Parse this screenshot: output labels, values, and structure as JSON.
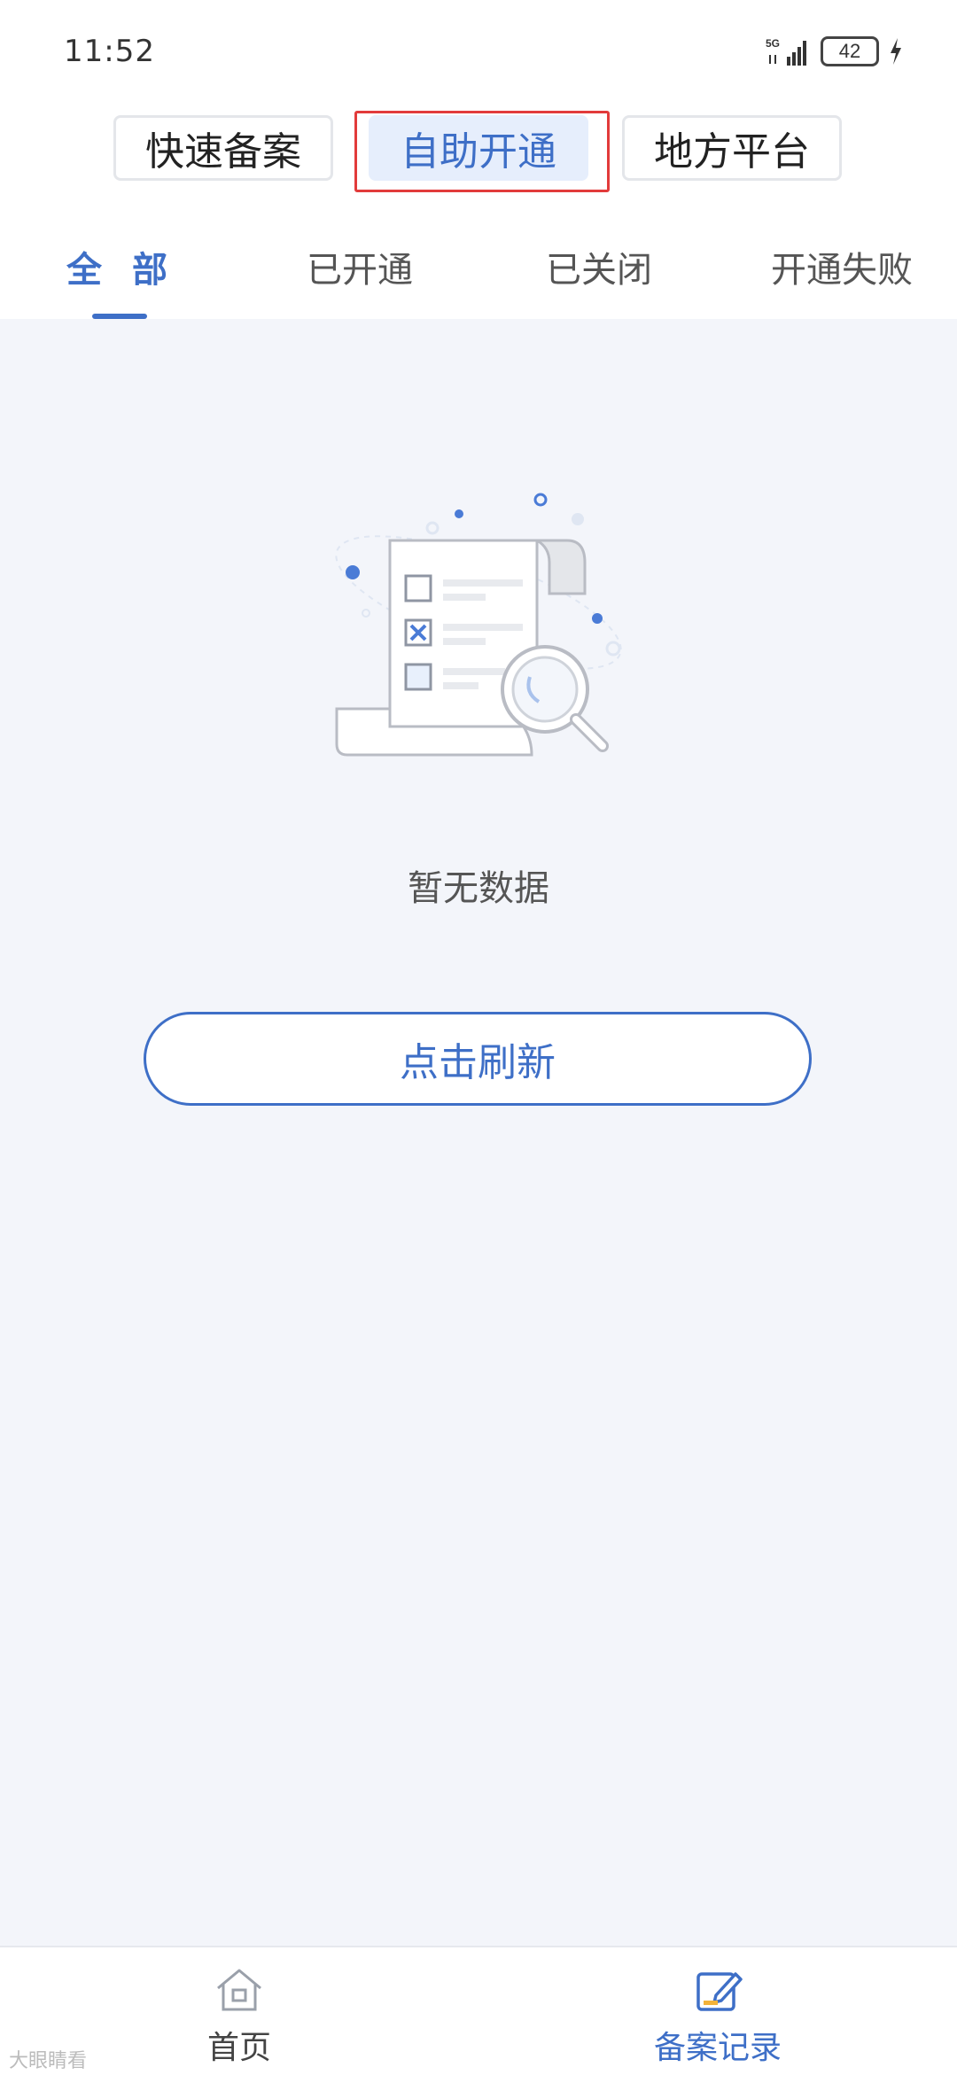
{
  "status_bar": {
    "time": "11:52",
    "network": "5G",
    "battery": "42"
  },
  "segments": [
    {
      "label": "快速备案",
      "active": false
    },
    {
      "label": "自助开通",
      "active": true
    },
    {
      "label": "地方平台",
      "active": false
    }
  ],
  "tabs": [
    {
      "label": "全 部",
      "active": true
    },
    {
      "label": "已开通",
      "active": false
    },
    {
      "label": "已关闭",
      "active": false
    },
    {
      "label": "开通失败",
      "active": false
    }
  ],
  "empty_state": {
    "message": "暂无数据",
    "refresh_label": "点击刷新"
  },
  "bottom_nav": [
    {
      "label": "首页",
      "icon": "home-icon",
      "active": false
    },
    {
      "label": "备案记录",
      "icon": "record-edit-icon",
      "active": true
    }
  ],
  "colors": {
    "accent": "#3e6fc7",
    "highlight_border": "#e23b3b",
    "background": "#f3f5fa"
  },
  "watermark": "大眼睛看"
}
